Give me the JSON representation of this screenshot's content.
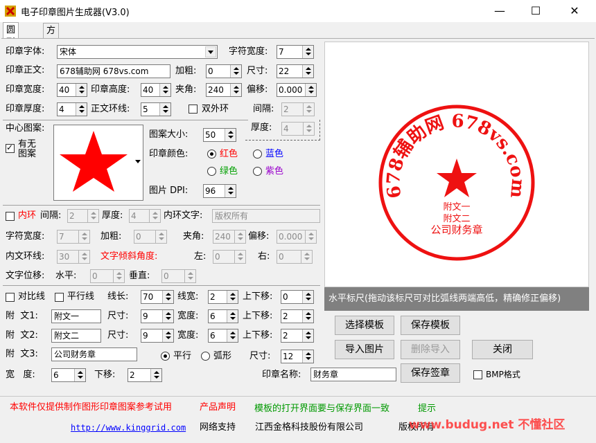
{
  "window": {
    "title": "电子印章图片生成器(V3.0)",
    "minimize": "—",
    "maximize": "☐",
    "close": "✕"
  },
  "tabs": [
    {
      "label": "圆形章",
      "active": true
    },
    {
      "label": "方形章",
      "active": false
    }
  ],
  "form": {
    "font_label": "印章字体:",
    "font_value": "宋体",
    "char_width_label": "字符宽度:",
    "char_width_value": "7",
    "body_text_label": "印章正文:",
    "body_text_value": "678辅助网 678vs.com",
    "bold_label": "加粗:",
    "bold_value": "0",
    "size_label": "尺寸:",
    "size_value": "22",
    "seal_width_label": "印章宽度:",
    "seal_width_value": "40",
    "seal_height_label": "印章高度:",
    "seal_height_value": "40",
    "angle_label": "夹角:",
    "angle_value": "240",
    "offset_label": "偏移:",
    "offset_value": "0.000",
    "thickness_label": "印章厚度:",
    "thickness_value": "4",
    "ring_label": "正文环线:",
    "ring_value": "5",
    "double_ring_label": "双外环",
    "double_ring_checked": false,
    "gap_label": "间隔:",
    "gap_value": "2",
    "gap_thick_label": "厚度:",
    "gap_thick_value": "4",
    "center_pattern_label": "中心图案:",
    "has_pattern_label": "有无\n图案",
    "has_pattern_checked": true,
    "pattern_size_label": "图案大小:",
    "pattern_size_value": "50",
    "color_label": "印章颜色:",
    "colors": [
      {
        "label": "红色",
        "color": "#ff0000",
        "checked": true
      },
      {
        "label": "蓝色",
        "color": "#0000ff",
        "checked": false
      },
      {
        "label": "绿色",
        "color": "#00a000",
        "checked": false
      },
      {
        "label": "紫色",
        "color": "#9900cc",
        "checked": false
      }
    ],
    "dpi_label": "图片 DPI:",
    "dpi_value": "96",
    "inner_ring_label": "内环",
    "inner_gap_label": "间隔:",
    "inner_gap_value": "2",
    "inner_thick_label": "厚度:",
    "inner_thick_value": "4",
    "inner_text_label": "内环文字:",
    "inner_text_value": "版权所有",
    "i_char_width_label": "字符宽度:",
    "i_char_width_value": "7",
    "i_bold_label": "加粗:",
    "i_bold_value": "0",
    "i_angle_label": "夹角:",
    "i_angle_value": "240",
    "i_offset_label": "偏移:",
    "i_offset_value": "0.000",
    "i_ring_label": "内文环线:",
    "i_ring_value": "30",
    "tilt_label": "文字倾斜角度:",
    "left_label": "左:",
    "left_value": "0",
    "right_label": "右:",
    "right_value": "0",
    "shift_label": "文字位移:",
    "h_label": "水平:",
    "h_value": "0",
    "v_label": "垂直:",
    "v_value": "0",
    "contrast_label": "对比线",
    "parallel_label": "平行线",
    "line_len_label": "线长:",
    "line_len_value": "70",
    "line_width_label": "线宽:",
    "line_width_value": "2",
    "line_shift_label": "上下移:",
    "line_shift_value": "0",
    "extra": [
      {
        "label": "附  文1:",
        "text": "附文一",
        "size_label": "尺寸:",
        "size": "9",
        "w_label": "宽度:",
        "w": "6",
        "shift_label": "上下移:",
        "shift": "2"
      },
      {
        "label": "附  文2:",
        "text": "附文二",
        "size_label": "尺寸:",
        "size": "9",
        "w_label": "宽度:",
        "w": "6",
        "shift_label": "上下移:",
        "shift": "2"
      }
    ],
    "extra3_label": "附  文3:",
    "extra3_text": "公司财务章",
    "flat_label": "平行",
    "arc_label": "弧形",
    "extra3_size_label": "尺寸:",
    "extra3_size": "12",
    "width2_label": "宽   度:",
    "width2_value": "6",
    "down_label": "下移:",
    "down_value": "2",
    "seal_name_label": "印章名称:",
    "seal_name_value": "财务章",
    "bmp_label": "BMP格式"
  },
  "buttons": {
    "select_template": "选择模板",
    "save_template": "保存模板",
    "import_image": "导入图片",
    "delete_import": "删除导入",
    "close": "关闭",
    "save_seal": "保存签章"
  },
  "preview": {
    "arc_text": "678辅助网 678vs.com",
    "line1": "附文一",
    "line2": "附文二",
    "line3": "公司财务章",
    "ruler_text": "水平标尺(拖动该标尺可对比弧线两端高低，精确修正偏移)"
  },
  "status": {
    "notice1": "本软件仅提供制作图形印章图案参考试用",
    "notice2": "产品声明",
    "notice3": "模板的打开界面要与保存界面一致",
    "notice4": "提示",
    "url": "http://www.kinggrid.com",
    "support": "网络支持",
    "company": "江西金格科技股份有限公司",
    "copyright": "版权所有",
    "watermark": "www.budug.net 不懂社区"
  },
  "colors": {
    "seal_red": "#ee1111",
    "notice_red": "#ff0000",
    "notice_green": "#009900"
  }
}
